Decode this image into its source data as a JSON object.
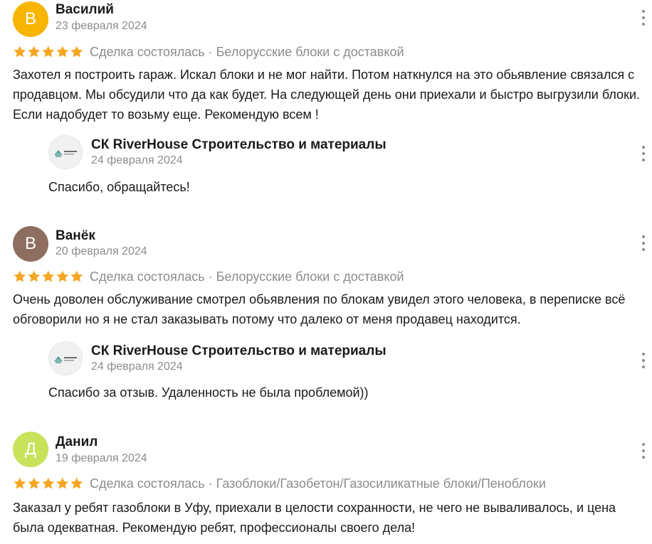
{
  "colors": {
    "star": "#f5a623",
    "meta_text": "#8c8c8c",
    "avatar_vasily": "#f7b500",
    "avatar_vanek": "#8e6e60",
    "avatar_danil": "#c9e25c"
  },
  "reviews": [
    {
      "initial": "В",
      "author": "Василий",
      "date": "23 февраля 2024",
      "rating": 5,
      "deal": "Сделка состоялась · Белорусские блоки с доставкой",
      "text": "Захотел я построить гараж. Искал блоки и не мог найти. Потом наткнулся на это обьявление связался с продавцом. Мы обсудили что да как будет. На следующей день они приехали и быстро выгрузили блоки. Если надобудет то возьму еще. Рекомендую всем !",
      "reply": {
        "name": "СК RiverHouse Строительство и материалы",
        "date": "24 февраля 2024",
        "text": "Спасибо, обращайтесь!"
      }
    },
    {
      "initial": "В",
      "author": "Ванёк",
      "date": "20 февраля 2024",
      "rating": 5,
      "deal": "Сделка состоялась · Белорусские блоки с доставкой",
      "text": "Очень доволен обслуживание смотрел обьявления по блокам увидел этого человека, в переписке всё обговорили но я не стал заказывать потому что далеко от меня продавец находится.",
      "reply": {
        "name": "СК RiverHouse Строительство и материалы",
        "date": "24 февраля 2024",
        "text": "Спасибо за отзыв. Удаленность не была проблемой))"
      }
    },
    {
      "initial": "Д",
      "author": "Данил",
      "date": "19 февраля 2024",
      "rating": 5,
      "deal": "Сделка состоялась · Газоблоки/Газобетон/Газосиликатные блоки/Пеноблоки",
      "text": "Заказал у ребят газоблоки в Уфу, приехали в целости сохранности, не чего не вываливалось, и цена была одекватная. Рекомендую ребят, профессионалы своего дела!"
    }
  ]
}
